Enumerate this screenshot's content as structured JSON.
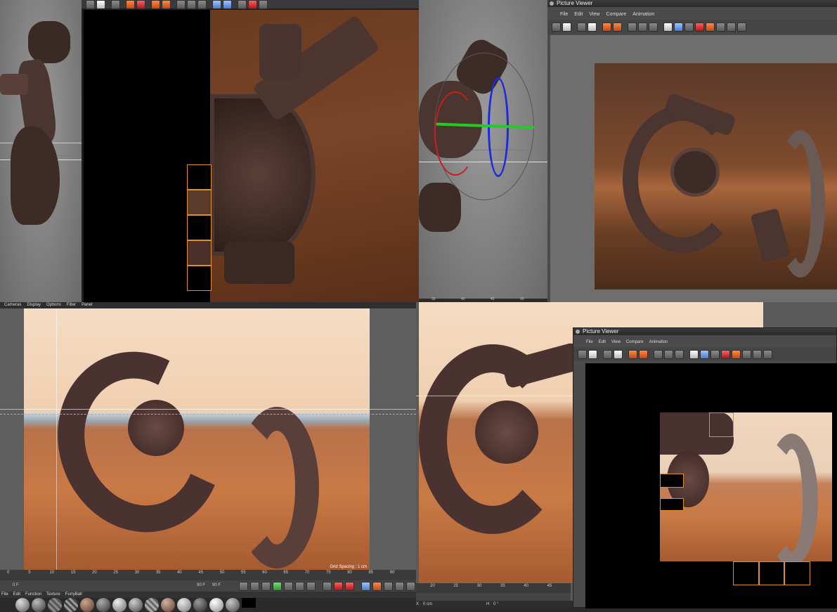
{
  "colors": {
    "accent_orange": "#e0902a",
    "desert_sand": "#c97a45",
    "sky": "#f5dcc4",
    "rust": "#7a4222",
    "grid": "#bdbdbd",
    "axis_green": "#22cc22",
    "axis_blue": "#1a2ae0",
    "axis_red": "#c81e1e"
  },
  "top_right_viewer": {
    "title": "Picture Viewer",
    "menu": [
      "File",
      "Edit",
      "View",
      "Compare",
      "Animation"
    ]
  },
  "bottom_right_viewer": {
    "title": "Picture Viewer",
    "menu": [
      "File",
      "Edit",
      "View",
      "Compare",
      "Animation"
    ]
  },
  "editor_viewport": {
    "menu": [
      "Cameras",
      "Display",
      "Options",
      "Filter",
      "Panel"
    ],
    "grid_spacing": "Grid Spacing : 1 cm"
  },
  "timeline": {
    "ticks": [
      "0",
      "5",
      "10",
      "15",
      "20",
      "25",
      "30",
      "35",
      "40",
      "45",
      "50",
      "55",
      "60",
      "65",
      "70",
      "75",
      "80",
      "85",
      "90"
    ],
    "current_frame": "0 F",
    "end_frame": "90 F",
    "end_frame_field": "90 F"
  },
  "mid_ruler": {
    "ticks": [
      "35",
      "40",
      "45",
      "50"
    ]
  },
  "br_ruler": {
    "ticks": [
      "20",
      "25",
      "30",
      "35",
      "40",
      "45"
    ]
  },
  "material_bar": {
    "menu": [
      "File",
      "Edit",
      "Function",
      "Texture",
      "FurryBall"
    ]
  },
  "coords": {
    "x_label": "X",
    "x_value": "0 cm",
    "h_label": "H",
    "h_value": "0 °"
  },
  "icons": [
    "open-icon",
    "save-icon",
    "render-icon",
    "camera-icon",
    "layer-icon",
    "gear-icon",
    "compare-a-icon",
    "compare-b-icon",
    "play-icon",
    "record-icon"
  ]
}
